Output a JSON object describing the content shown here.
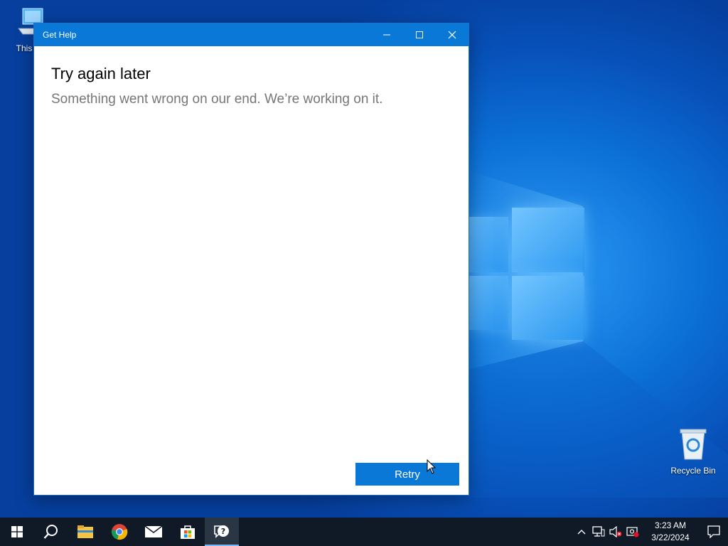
{
  "desktop": {
    "icons": [
      {
        "label": "This PC"
      },
      {
        "label": "Recycle Bin"
      }
    ]
  },
  "window": {
    "title": "Get Help",
    "heading": "Try again later",
    "message": "Something went wrong on our end. We’re working on it.",
    "retry_label": "Retry",
    "controls": [
      "minimize-icon",
      "maximize-icon",
      "close-icon"
    ]
  },
  "taskbar": {
    "apps": [
      "start-icon",
      "search-icon",
      "file-explorer-icon",
      "chrome-icon",
      "mail-icon",
      "store-icon",
      "get-help-icon"
    ],
    "active_app": "get-help-icon",
    "tray": [
      "chevron-up-icon",
      "network-icon",
      "volume-muted-icon",
      "security-icon"
    ],
    "time": "3:23 AM",
    "date": "3/22/2024"
  },
  "colors": {
    "accent": "#0a78d7",
    "taskbar": "#101a26"
  }
}
